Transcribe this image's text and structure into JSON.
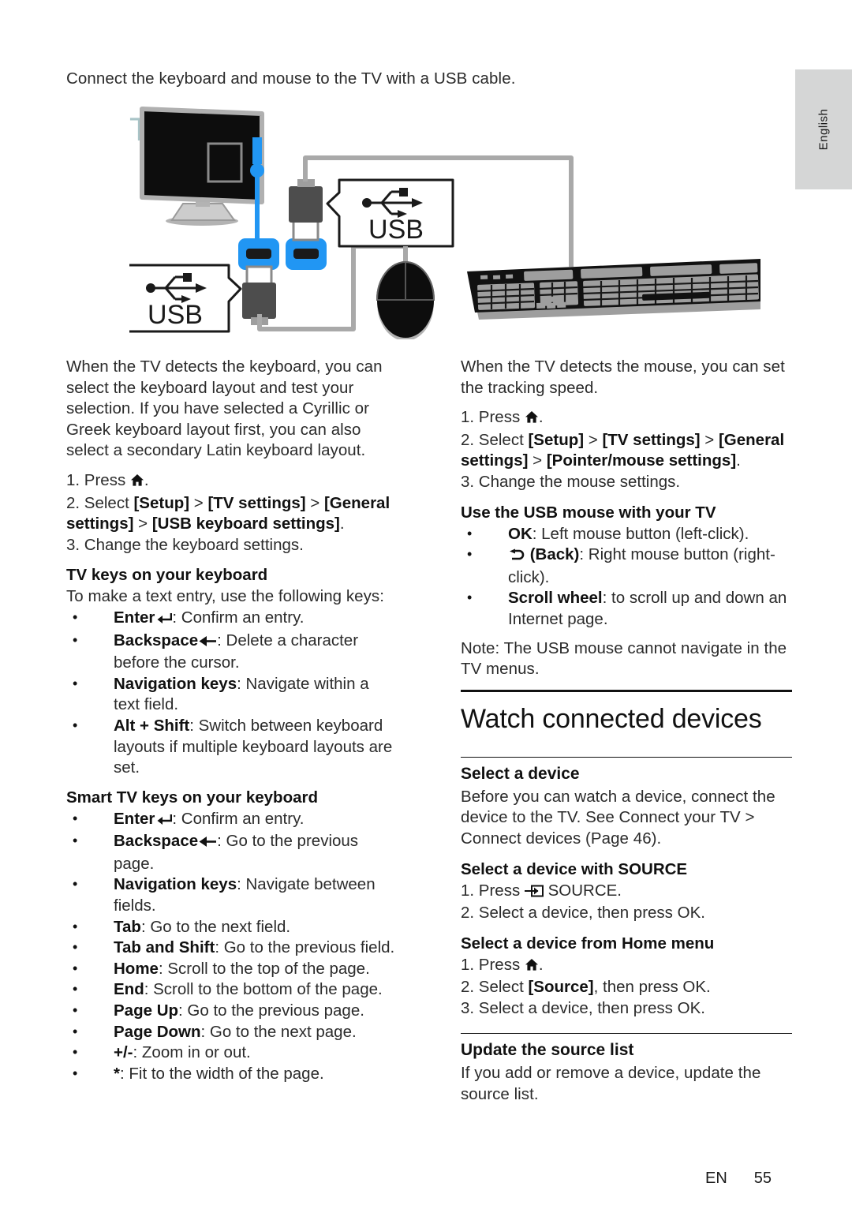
{
  "page": {
    "language_tab": "English",
    "footer_lang": "EN",
    "footer_page": "55",
    "intro": "Connect the keyboard and mouse to the TV with a USB cable."
  },
  "diagram": {
    "tv_label": "TV",
    "usb_label_1": "USB",
    "usb_label_2": "USB",
    "colors": {
      "accent_blue": "#2196f3",
      "tv_teal": "#a8c4c7",
      "cable_gray": "#a9a9a9",
      "device_dark": "#4d4d4d"
    }
  },
  "left_column": {
    "intro_para": "When the TV detects the keyboard, you can select the keyboard layout and test your selection. If you have selected a Cyrillic or Greek keyboard layout first, you can also select a secondary Latin keyboard layout.",
    "step1_prefix": "1. Press ",
    "step1_suffix": ".",
    "step2_prefix": "2. Select ",
    "step2_path1": "[Setup]",
    "step2_sep": " > ",
    "step2_path2": "[TV settings]",
    "step2_path3": "[General settings]",
    "step2_path4": "[USB keyboard settings]",
    "step2_suffix": ".",
    "step3": "3. Change the keyboard settings.",
    "tv_keys_heading": "TV keys on your keyboard",
    "tv_keys_intro": "To make a text entry, use the following keys:",
    "tv_keys": [
      {
        "key": "Enter",
        "icon": "enter-arrow-icon",
        "desc": ": Confirm an entry."
      },
      {
        "key": "Backspace",
        "icon": "backspace-arrow-icon",
        "desc": ": Delete a character before the cursor."
      },
      {
        "key": "Navigation keys",
        "icon": "",
        "desc": ": Navigate within a text field."
      },
      {
        "key": "Alt + Shift",
        "icon": "",
        "desc": ": Switch between keyboard layouts if multiple keyboard layouts are set."
      }
    ],
    "smart_keys_heading": "Smart TV keys on your keyboard",
    "smart_keys": [
      {
        "key": "Enter",
        "icon": "enter-arrow-icon",
        "desc": ": Confirm an entry."
      },
      {
        "key": "Backspace",
        "icon": "backspace-arrow-icon",
        "desc": ": Go to the previous page."
      },
      {
        "key": "Navigation keys",
        "icon": "",
        "desc": ": Navigate between fields."
      },
      {
        "key": "Tab",
        "icon": "",
        "desc": ": Go to the next field."
      },
      {
        "key": "Tab and Shift",
        "icon": "",
        "desc": ": Go to the previous field."
      },
      {
        "key": "Home",
        "icon": "",
        "desc": ": Scroll to the top of the page."
      },
      {
        "key": "End",
        "icon": "",
        "desc": ": Scroll to the bottom of the page."
      },
      {
        "key": "Page Up",
        "icon": "",
        "desc": ": Go to the previous page."
      },
      {
        "key": "Page Down",
        "icon": "",
        "desc": ": Go to the next page."
      },
      {
        "key": "+/-",
        "icon": "",
        "desc": ": Zoom in or out."
      },
      {
        "key": "*",
        "icon": "",
        "desc": ": Fit to the width of the page."
      }
    ]
  },
  "right_column": {
    "mouse_intro": "When the TV detects the mouse, you can set the tracking speed.",
    "m_step1_prefix": "1. Press ",
    "m_step1_suffix": ".",
    "m_step2_prefix": "2. Select ",
    "m_path1": "[Setup]",
    "m_path2": "[TV settings]",
    "m_path3": "[General settings]",
    "m_path4": "[Pointer/mouse settings]",
    "m_step2_suffix": ".",
    "m_step3": "3. Change the mouse settings.",
    "usb_mouse_heading": "Use the USB mouse with your TV",
    "mouse_bullets": [
      {
        "key": "OK",
        "icon": "",
        "desc": ": Left mouse button (left-click)."
      },
      {
        "key": "(Back)",
        "icon": "back-arrow-icon",
        "desc": ": Right mouse button (right-click)."
      },
      {
        "key": "Scroll wheel",
        "icon": "",
        "desc": ": to scroll up and down an Internet page."
      }
    ],
    "note_label": "Note:",
    "note_text": " The USB mouse cannot navigate in the TV menus.",
    "section_title": "Watch connected devices",
    "select_device": {
      "heading": "Select a device",
      "body_1": "Before you can watch a device, connect the device to the TV. See ",
      "body_bold": "Connect your TV > Connect devices",
      "body_2": " (Page 46).",
      "source_heading": "Select a device with SOURCE",
      "source_step1_prefix": "1. Press ",
      "source_step1_label": " SOURCE.",
      "source_step2": "2. Select a device, then press OK.",
      "home_heading": "Select a device from Home menu",
      "home_step1_prefix": "1. Press ",
      "home_step1_suffix": ".",
      "home_step2_prefix": "2. Select ",
      "home_step2_bold": "[Source]",
      "home_step2_suffix": ", then press OK.",
      "home_step3": "3. Select a device, then press OK."
    },
    "update_source": {
      "heading": "Update the source list",
      "body": "If you add or remove a device, update the source list."
    }
  }
}
